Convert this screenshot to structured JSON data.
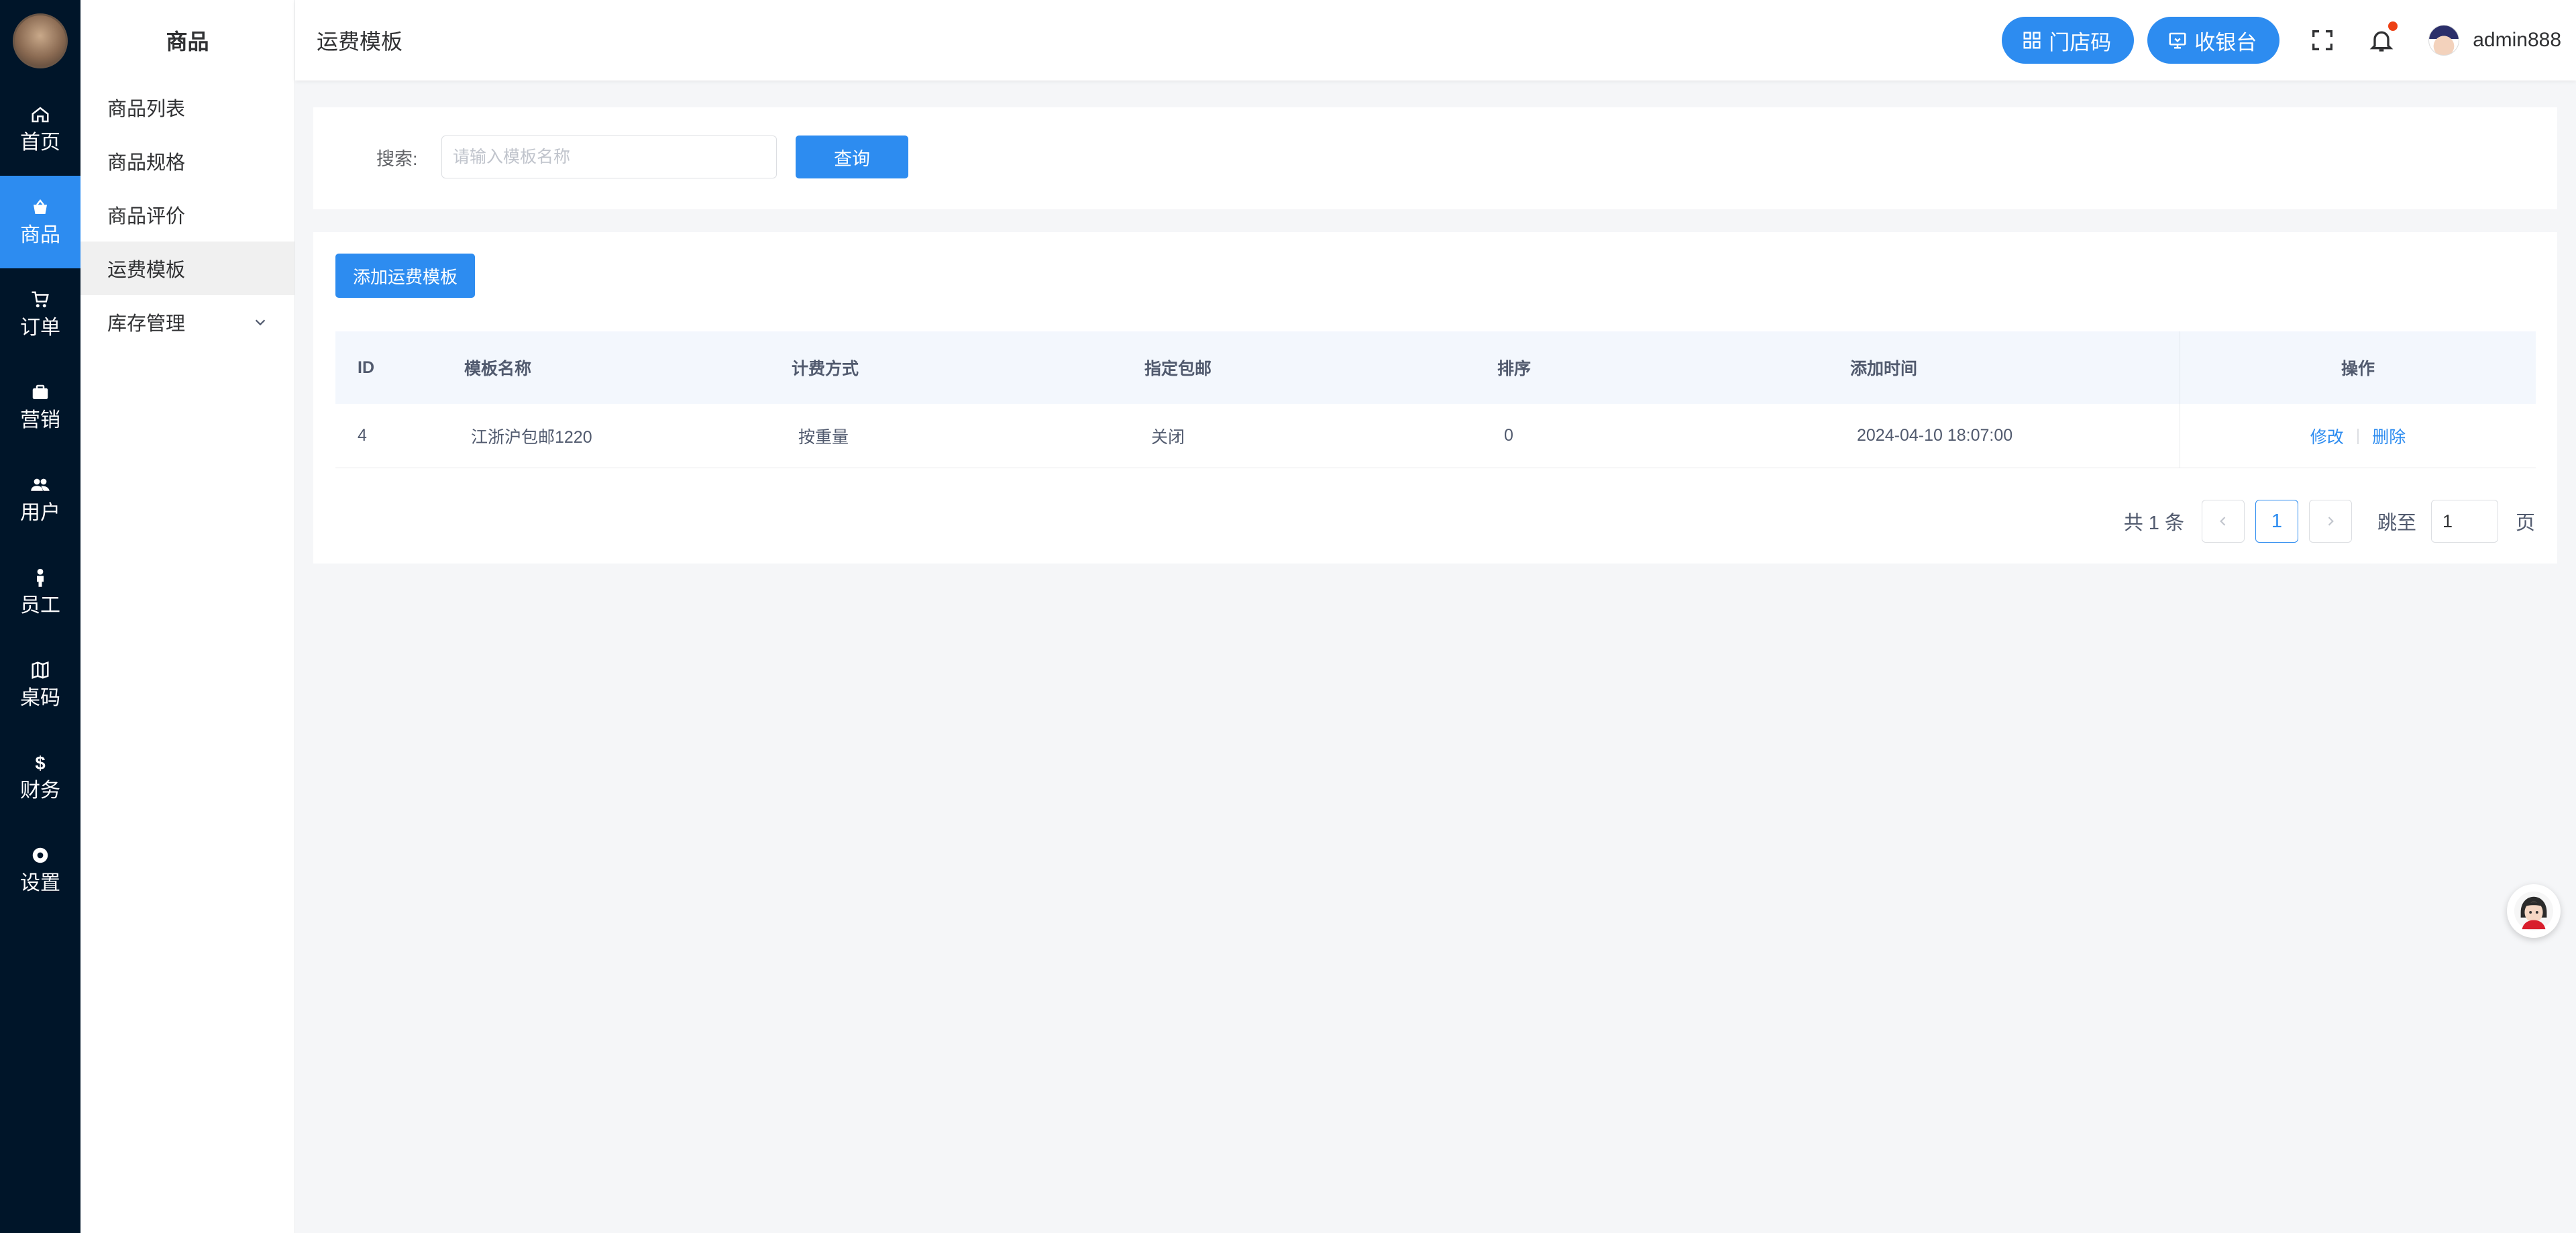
{
  "rail": {
    "items": [
      {
        "label": "首页",
        "icon": "home-icon"
      },
      {
        "label": "商品",
        "icon": "bag-icon",
        "active": true
      },
      {
        "label": "订单",
        "icon": "cart-icon"
      },
      {
        "label": "营销",
        "icon": "briefcase-icon"
      },
      {
        "label": "用户",
        "icon": "users-icon"
      },
      {
        "label": "员工",
        "icon": "person-icon"
      },
      {
        "label": "桌码",
        "icon": "map-icon"
      },
      {
        "label": "财务",
        "icon": "dollar-icon"
      },
      {
        "label": "设置",
        "icon": "gear-icon"
      }
    ]
  },
  "submenu": {
    "title": "商品",
    "items": [
      {
        "label": "商品列表"
      },
      {
        "label": "商品规格"
      },
      {
        "label": "商品评价"
      },
      {
        "label": "运费模板",
        "active": true
      },
      {
        "label": "库存管理",
        "has_children": true
      }
    ]
  },
  "header": {
    "breadcrumb": "运费模板",
    "store_code_label": "门店码",
    "cashier_label": "收银台",
    "username": "admin888"
  },
  "search": {
    "label": "搜索:",
    "placeholder": "请输入模板名称",
    "value": "",
    "query_label": "查询"
  },
  "table": {
    "add_label": "添加运费模板",
    "columns": [
      "ID",
      "模板名称",
      "计费方式",
      "指定包邮",
      "排序",
      "添加时间",
      "操作"
    ],
    "rows": [
      {
        "id": "4",
        "name": "江浙沪包邮1220",
        "billing": "按重量",
        "free_shipping": "关闭",
        "sort": "0",
        "added": "2024-04-10 18:07:00",
        "edit_label": "修改",
        "delete_label": "删除"
      }
    ]
  },
  "pagination": {
    "total_text": "共 1 条",
    "current_page": "1",
    "jump_label": "跳至",
    "jump_value": "1",
    "page_suffix": "页"
  },
  "colors": {
    "accent": "#2d8cf0",
    "rail_bg": "#001529",
    "notification_dot": "#ed4014"
  }
}
